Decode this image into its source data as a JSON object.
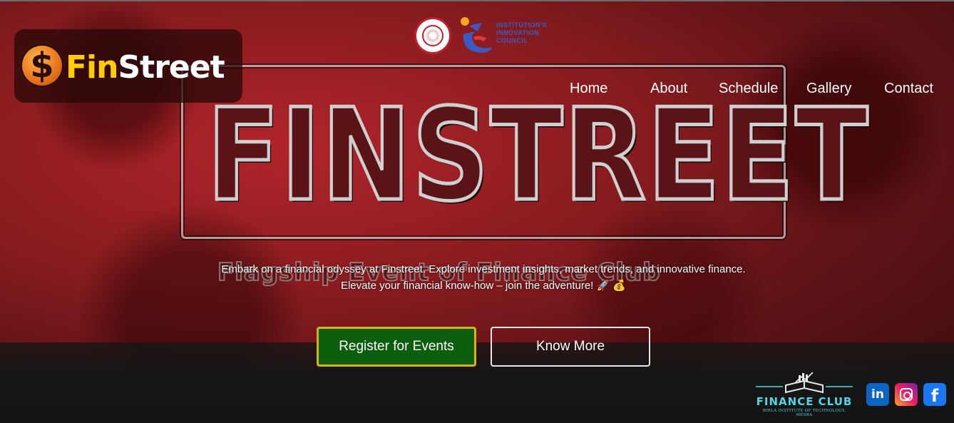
{
  "brand": {
    "logo_symbol": "$",
    "logo_fin": "Fin",
    "logo_street": "Street"
  },
  "header": {
    "iic_text_line1": "INSTITUTION'S",
    "iic_text_line2": "INNOVATION",
    "iic_text_line3": "COUNCIL"
  },
  "nav": {
    "items": [
      {
        "label": "Home"
      },
      {
        "label": "About"
      },
      {
        "label": "Schedule"
      },
      {
        "label": "Gallery"
      },
      {
        "label": "Contact"
      }
    ]
  },
  "hero": {
    "banner_title": "FINSTREET",
    "banner_subtitle": "Flagship Event of Finance Club",
    "tagline_line1": "Embark on a financial odyssey at Finstreet. Explore investment insights, market trends, and innovative finance.",
    "tagline_line2": "Elevate your financial know-how – join the adventure! 🚀 💰"
  },
  "actions": {
    "register_label": "Register for Events",
    "know_more_label": "Know More"
  },
  "footer": {
    "club_name": "FINANCE CLUB",
    "club_institute": "BIRLA INSTITUTE OF TECHNOLOGY, MESRA",
    "social": {
      "linkedin": "in",
      "facebook": "f"
    }
  },
  "colors": {
    "accent_gold": "#ffcc00",
    "register_bg": "#0e5e10",
    "register_border": "#d4b418",
    "club_teal": "#4fd6e0"
  }
}
